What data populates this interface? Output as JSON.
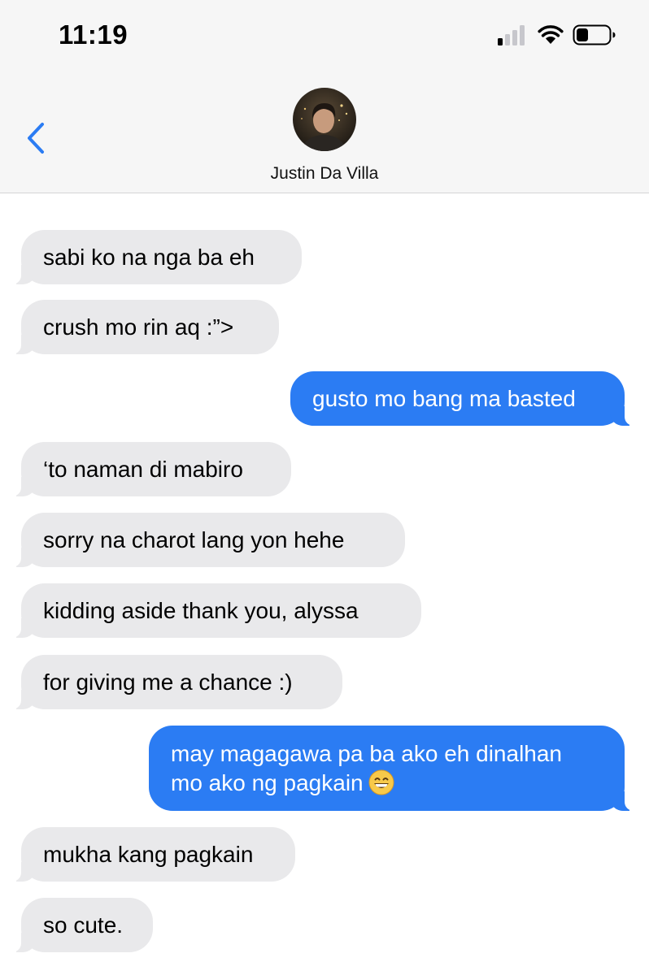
{
  "status_bar": {
    "time": "11:19"
  },
  "contact": {
    "name": "Justin Da Villa"
  },
  "messages": [
    {
      "dir": "in",
      "text": "sabi ko na nga ba eh"
    },
    {
      "dir": "in",
      "text": "crush mo rin aq :”>"
    },
    {
      "dir": "out",
      "text": "gusto mo bang ma basted"
    },
    {
      "dir": "in",
      "text": "‘to naman di mabiro"
    },
    {
      "dir": "in",
      "text": "sorry na charot lang yon hehe"
    },
    {
      "dir": "in",
      "text": "kidding aside thank you, alyssa"
    },
    {
      "dir": "in",
      "text": "for giving me a chance :)"
    },
    {
      "dir": "out",
      "line1": "may magagawa pa ba ako eh dinalhan",
      "line2": "mo ako ng pagkain",
      "emoji": "grinning-face-emoji"
    },
    {
      "dir": "in",
      "text": "mukha kang pagkain"
    },
    {
      "dir": "in",
      "text": "so cute."
    }
  ],
  "colors": {
    "incoming": "#e9e9eb",
    "outgoing": "#2b7cf3",
    "accent": "#2b7cf3"
  }
}
